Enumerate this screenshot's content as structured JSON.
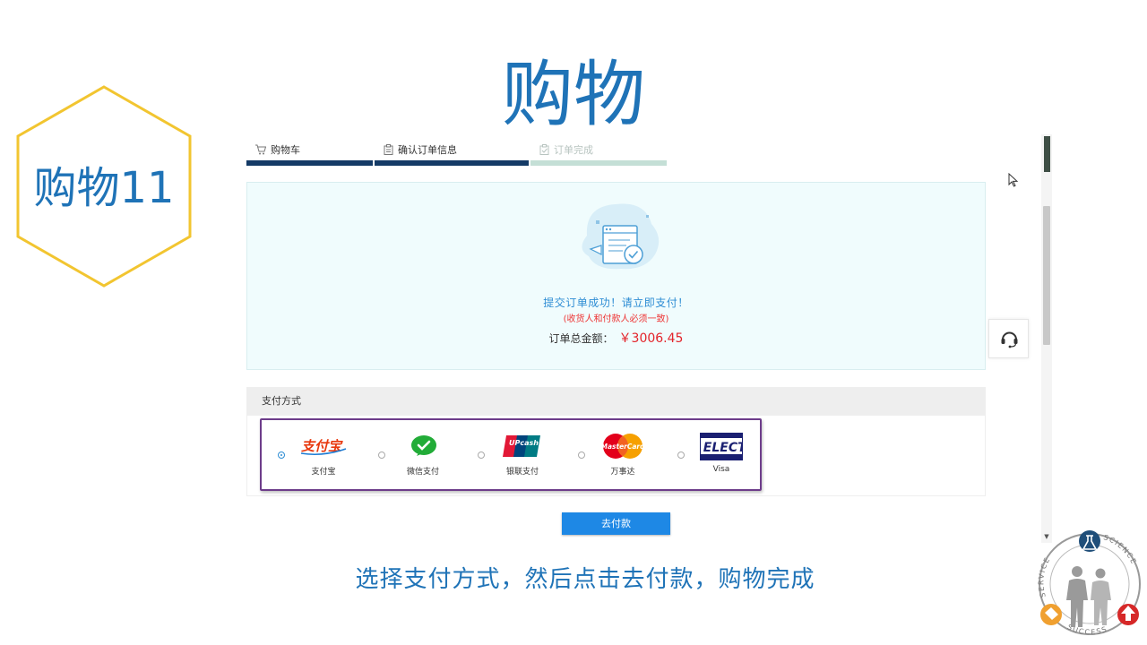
{
  "slide": {
    "title": "购物",
    "badge_label": "购物11",
    "instruction": "选择支付方式，然后点击去付款，购物完成"
  },
  "steps": [
    {
      "label": "购物车",
      "icon": "cart-icon",
      "state": "active"
    },
    {
      "label": "确认订单信息",
      "icon": "clipboard-icon",
      "state": "active"
    },
    {
      "label": "订单完成",
      "icon": "clipboard-check-icon",
      "state": "pending"
    }
  ],
  "order": {
    "success_message": "提交订单成功！请立即支付！",
    "consistency_note": "(收货人和付款人必须一致)",
    "total_label": "订单总金额：",
    "total_amount": "￥3006.45"
  },
  "payment": {
    "section_title": "支付方式",
    "methods": [
      {
        "label": "支付宝",
        "logo": "支付宝",
        "selected": true
      },
      {
        "label": "微信支付",
        "logo": "wechat-pay-icon",
        "selected": false
      },
      {
        "label": "银联支付",
        "logo": "UPcash 银联",
        "selected": false
      },
      {
        "label": "万事达",
        "logo": "MasterCard",
        "selected": false
      },
      {
        "label": "Visa",
        "logo": "VISA ELECTRON",
        "selected": false
      }
    ],
    "pay_button": "去付款"
  },
  "emblem": {
    "top_text": "SERVICE",
    "right_text": "SCIENCE",
    "bottom_text": "SUCCESS"
  },
  "colors": {
    "title_blue": "#1f73b7",
    "hex_border": "#f2c530",
    "step_done": "#143a66",
    "step_pending": "#c4dfd6",
    "price_red": "#e3242b",
    "highlight_purple": "#6d3c8a",
    "button_blue": "#1e88e5"
  }
}
